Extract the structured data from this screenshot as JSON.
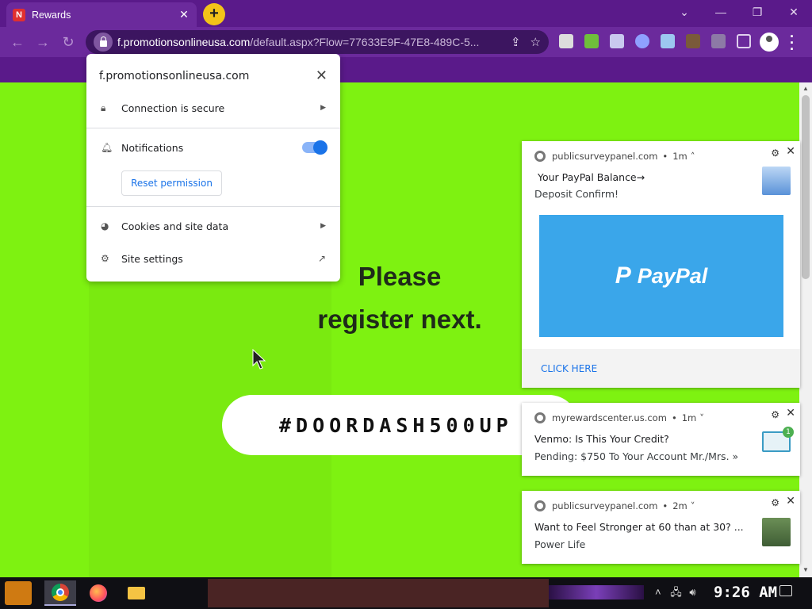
{
  "browser": {
    "tab_title": "Rewards",
    "tab_favicon": "N",
    "tab_close": "✕",
    "new_tab": "+",
    "url_host": "f.promotionsonlineusa.com",
    "url_rest": "/default.aspx?Flow=77633E9F-47E8-489C-5..."
  },
  "site_info": {
    "host": "f.promotionsonlineusa.com",
    "connection": "Connection is secure",
    "notifications": "Notifications",
    "notifications_enabled": true,
    "reset_permission": "Reset permission",
    "cookies": "Cookies and site data",
    "site_settings": "Site settings"
  },
  "page": {
    "headline_1": "Please",
    "headline_2": "register next.",
    "promo_code": "#DOORDASH500UP"
  },
  "notifications": [
    {
      "source": "publicsurveypanel.com",
      "age": "1m",
      "title": "Your PayPal Balance→",
      "body": "Deposit Confirm!",
      "image_text": "PayPal",
      "action": "CLICK HERE"
    },
    {
      "source": "myrewardscenter.us.com",
      "age": "1m",
      "title": "Venmo:  Is This Your Credit?",
      "body": "Pending: $750 To Your Account Mr./Mrs.  »",
      "badge": "1"
    },
    {
      "source": "publicsurveypanel.com",
      "age": "2m",
      "title": "Want to Feel Stronger at 60 than at 30? ...",
      "body": "Power Life"
    }
  ],
  "taskbar": {
    "clock": "9:26 AM"
  },
  "colors": {
    "page_bg": "#7ef211",
    "browser_purple": "#6b2a9c",
    "paypal_blue": "#3aa6ea",
    "link_blue": "#1a73e8"
  }
}
